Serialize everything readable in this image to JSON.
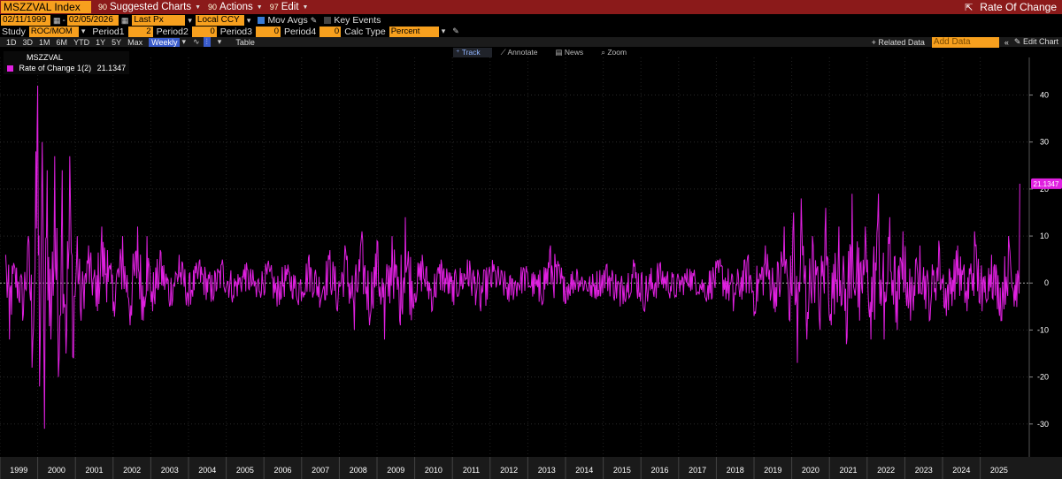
{
  "topbar": {
    "ticker": "MSZZVAL Index",
    "suggested_num": "90",
    "suggested_label": "Suggested Charts",
    "actions_num": "90",
    "actions_label": "Actions",
    "edit_num": "97",
    "edit_label": "Edit",
    "title": "Rate Of Change"
  },
  "controls": {
    "start_date": "02/11/1999",
    "end_date": "02/05/2026",
    "price_field": "Last Px",
    "currency": "Local CCY",
    "mov_avgs": "Mov Avgs",
    "key_events": "Key Events",
    "study_label": "Study",
    "study_value": "ROC/MOM",
    "period1_label": "Period1",
    "period1_value": "2",
    "period2_label": "Period2",
    "period2_value": "0",
    "period3_label": "Period3",
    "period3_value": "0",
    "period4_label": "Period4",
    "period4_value": "0",
    "calc_label": "Calc Type",
    "calc_value": "Percent"
  },
  "timeframes": [
    "1D",
    "3D",
    "1M",
    "6M",
    "YTD",
    "1Y",
    "5Y",
    "Max"
  ],
  "frequency": "Weekly",
  "table_label": "Table",
  "related_data": "+ Related Data",
  "add_data_placeholder": "Add Data",
  "edit_chart": "Edit Chart",
  "chart_toolbar": [
    "Track",
    "Annotate",
    "News",
    "Zoom"
  ],
  "legend": {
    "header": "MSZZVAL",
    "series_label": "Rate of Change 1(2)",
    "series_value": "21.1347"
  },
  "colors": {
    "series": "#e020e0",
    "accent": "#f7a01e",
    "topbar": "#8b1a1a"
  },
  "chart_data": {
    "type": "line",
    "series": [
      {
        "name": "Rate of Change 1(2)",
        "x_start": 1999.11,
        "x_end": 2026.1,
        "peaks": [
          [
            1999.15,
            6
          ],
          [
            1999.25,
            -12
          ],
          [
            1999.4,
            3
          ],
          [
            1999.6,
            -8
          ],
          [
            1999.75,
            10
          ],
          [
            1999.85,
            -18
          ],
          [
            1999.95,
            28
          ],
          [
            2000.0,
            42
          ],
          [
            2000.05,
            -22
          ],
          [
            2000.12,
            30
          ],
          [
            2000.18,
            -31
          ],
          [
            2000.25,
            24
          ],
          [
            2000.35,
            -12
          ],
          [
            2000.45,
            27
          ],
          [
            2000.55,
            -20
          ],
          [
            2000.65,
            24
          ],
          [
            2000.75,
            -15
          ],
          [
            2000.85,
            27
          ],
          [
            2000.95,
            -16
          ],
          [
            2001.05,
            10
          ],
          [
            2001.15,
            -8
          ],
          [
            2001.35,
            8
          ],
          [
            2001.55,
            -5
          ],
          [
            2001.7,
            12
          ],
          [
            2001.85,
            7
          ],
          [
            2002.0,
            -6
          ],
          [
            2002.25,
            10
          ],
          [
            2002.45,
            -9
          ],
          [
            2002.65,
            12
          ],
          [
            2002.8,
            -8
          ],
          [
            2002.9,
            10
          ],
          [
            2003.05,
            -6
          ],
          [
            2003.25,
            7
          ],
          [
            2003.5,
            -5
          ],
          [
            2003.75,
            6
          ],
          [
            2004.0,
            -5
          ],
          [
            2004.3,
            5
          ],
          [
            2004.6,
            -4
          ],
          [
            2004.9,
            5
          ],
          [
            2005.2,
            -3
          ],
          [
            2005.5,
            4
          ],
          [
            2005.8,
            -3
          ],
          [
            2006.1,
            4
          ],
          [
            2006.35,
            -5
          ],
          [
            2006.6,
            3
          ],
          [
            2006.9,
            -4
          ],
          [
            2007.2,
            6
          ],
          [
            2007.5,
            -4
          ],
          [
            2007.75,
            7
          ],
          [
            2007.95,
            -6
          ],
          [
            2008.15,
            8
          ],
          [
            2008.4,
            -10
          ],
          [
            2008.6,
            11
          ],
          [
            2008.8,
            -9
          ],
          [
            2009.0,
            9
          ],
          [
            2009.2,
            -12
          ],
          [
            2009.4,
            10
          ],
          [
            2009.6,
            -8
          ],
          [
            2009.75,
            14
          ],
          [
            2009.95,
            -5
          ],
          [
            2010.2,
            6
          ],
          [
            2010.45,
            -6
          ],
          [
            2010.7,
            5
          ],
          [
            2011.0,
            -4
          ],
          [
            2011.4,
            5
          ],
          [
            2011.75,
            -6
          ],
          [
            2012.1,
            4
          ],
          [
            2012.5,
            -4
          ],
          [
            2012.9,
            3
          ],
          [
            2013.3,
            -4
          ],
          [
            2013.6,
            8
          ],
          [
            2013.95,
            -4
          ],
          [
            2014.3,
            3
          ],
          [
            2014.7,
            -3
          ],
          [
            2015.1,
            4
          ],
          [
            2015.45,
            -5
          ],
          [
            2015.8,
            5
          ],
          [
            2016.1,
            -6
          ],
          [
            2016.5,
            4
          ],
          [
            2016.9,
            -3
          ],
          [
            2017.3,
            3
          ],
          [
            2017.7,
            -3
          ],
          [
            2018.1,
            5
          ],
          [
            2018.45,
            -6
          ],
          [
            2018.85,
            6
          ],
          [
            2019.0,
            -7
          ],
          [
            2019.3,
            8
          ],
          [
            2019.6,
            -5
          ],
          [
            2019.8,
            12
          ],
          [
            2019.95,
            -8
          ],
          [
            2020.05,
            15
          ],
          [
            2020.15,
            -17
          ],
          [
            2020.25,
            18
          ],
          [
            2020.4,
            -12
          ],
          [
            2020.55,
            10
          ],
          [
            2020.75,
            -10
          ],
          [
            2020.9,
            16
          ],
          [
            2021.05,
            -9
          ],
          [
            2021.25,
            12
          ],
          [
            2021.45,
            -13
          ],
          [
            2021.6,
            19
          ],
          [
            2021.8,
            -8
          ],
          [
            2021.95,
            12
          ],
          [
            2022.1,
            -12
          ],
          [
            2022.3,
            19
          ],
          [
            2022.45,
            -12
          ],
          [
            2022.6,
            14
          ],
          [
            2022.8,
            -10
          ],
          [
            2022.95,
            11
          ],
          [
            2023.15,
            -8
          ],
          [
            2023.4,
            8
          ],
          [
            2023.65,
            -8
          ],
          [
            2023.9,
            9
          ],
          [
            2024.1,
            -7
          ],
          [
            2024.4,
            8
          ],
          [
            2024.65,
            -6
          ],
          [
            2024.85,
            11
          ],
          [
            2025.05,
            -6
          ],
          [
            2025.3,
            6
          ],
          [
            2025.55,
            -8
          ],
          [
            2025.75,
            10
          ],
          [
            2025.9,
            -5
          ],
          [
            2025.95,
            2
          ],
          [
            2026.05,
            21.1347
          ]
        ]
      }
    ],
    "last_value": "21.1347",
    "xlim": [
      1999.0,
      2026.3
    ],
    "ylim": [
      -37,
      48
    ],
    "x_ticks": [
      "1999",
      "2000",
      "2001",
      "2002",
      "2003",
      "2004",
      "2005",
      "2006",
      "2007",
      "2008",
      "2009",
      "2010",
      "2011",
      "2012",
      "2013",
      "2014",
      "2015",
      "2016",
      "2017",
      "2018",
      "2019",
      "2020",
      "2021",
      "2022",
      "2023",
      "2024",
      "2025"
    ],
    "y_ticks": [
      40,
      30,
      20,
      10,
      0,
      -10,
      -20,
      -30
    ],
    "grid": "dotted",
    "legend_position": "top-left"
  }
}
